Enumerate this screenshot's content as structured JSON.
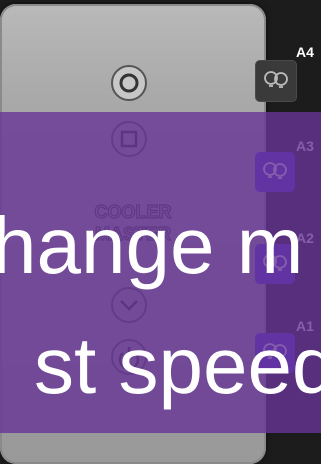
{
  "keys": [
    {
      "id": "A4",
      "label": "A4",
      "icon": "bulbs-icon",
      "state": "inactive"
    },
    {
      "id": "A3",
      "label": "A3",
      "icon": "bulbs-icon",
      "state": "active"
    },
    {
      "id": "A2",
      "label": "A2",
      "icon": "bulbs-icon",
      "state": "active"
    },
    {
      "id": "A1",
      "label": "A1",
      "icon": "bulbs-icon",
      "state": "active"
    }
  ],
  "caption": {
    "line1": "hange m",
    "line2": "st speed"
  },
  "device": {
    "brand": "COOLER MASTER"
  },
  "colors": {
    "overlay": "#673496",
    "key_active": "#4a2fd6",
    "key_inactive": "#3a3a3a"
  }
}
